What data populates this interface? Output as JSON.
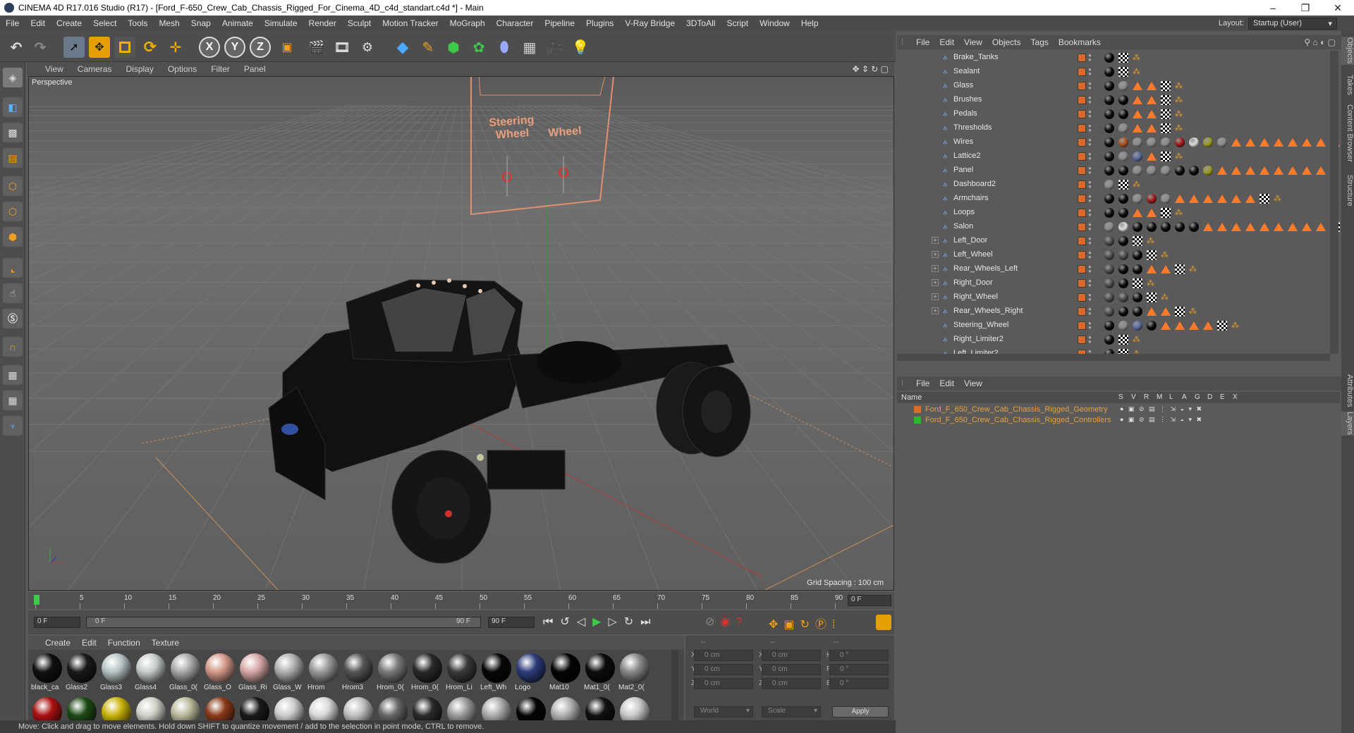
{
  "window": {
    "title": "CINEMA 4D R17.016 Studio (R17) - [Ford_F-650_Crew_Cab_Chassis_Rigged_For_Cinema_4D_c4d_standart.c4d *] - Main",
    "minimize": "–",
    "maximize": "❐",
    "close": "✕"
  },
  "menu": [
    "File",
    "Edit",
    "Create",
    "Select",
    "Tools",
    "Mesh",
    "Snap",
    "Animate",
    "Simulate",
    "Render",
    "Sculpt",
    "Motion Tracker",
    "MoGraph",
    "Character",
    "Pipeline",
    "Plugins",
    "V-Ray Bridge",
    "3DToAll",
    "Script",
    "Window",
    "Help"
  ],
  "layout": {
    "label": "Layout:",
    "value": "Startup (User)"
  },
  "toolbar": {
    "axis_x": "X",
    "axis_y": "Y",
    "axis_z": "Z"
  },
  "viewport": {
    "menu": [
      "View",
      "Cameras",
      "Display",
      "Options",
      "Filter",
      "Panel"
    ],
    "label": "Perspective",
    "grid_spacing": "Grid Spacing : 100 cm",
    "controller_labels": [
      "Steering Wheel",
      "Wheel"
    ]
  },
  "timeline": {
    "ticks": [
      "0",
      "5",
      "10",
      "15",
      "20",
      "25",
      "30",
      "35",
      "40",
      "45",
      "50",
      "55",
      "60",
      "65",
      "70",
      "75",
      "80",
      "85",
      "90"
    ],
    "current_frame": "0 F",
    "start_field": "0 F",
    "range_start": "0 F",
    "range_end": "90 F",
    "end_field": "90 F"
  },
  "materials": {
    "menu": [
      "Create",
      "Edit",
      "Function",
      "Texture"
    ],
    "row1": [
      {
        "name": "black_ca",
        "color": "#111111"
      },
      {
        "name": "Glass2",
        "color": "#1a1a1a"
      },
      {
        "name": "Glass3",
        "color": "#b8c4c4"
      },
      {
        "name": "Glass4",
        "color": "#c8cccc"
      },
      {
        "name": "Glass_0(",
        "color": "#a8aaaa"
      },
      {
        "name": "Glass_O",
        "color": "#d49a8a"
      },
      {
        "name": "Glass_Ri",
        "color": "#d8a8a8"
      },
      {
        "name": "Glass_W",
        "color": "#b0b0b0"
      },
      {
        "name": "Hrom",
        "color": "#9a9a9a"
      },
      {
        "name": "Hrom3",
        "color": "#555555"
      },
      {
        "name": "Hrom_0(",
        "color": "#7a7a7a"
      },
      {
        "name": "Hrom_0(",
        "color": "#2a2a2a"
      },
      {
        "name": "Hrom_Li",
        "color": "#3a3a3a"
      },
      {
        "name": "Left_Wh",
        "color": "#080808"
      },
      {
        "name": "Logo",
        "color": "#2c3c7a"
      },
      {
        "name": "Mat10",
        "color": "#050505"
      },
      {
        "name": "Mat1_0(",
        "color": "#0c0c0c"
      },
      {
        "name": "Mat2_0(",
        "color": "#888888"
      }
    ],
    "row2": [
      "#aa1111",
      "#1e4a14",
      "#c9b20c",
      "#d0d0c8",
      "#b8b89a",
      "#8a3a1a",
      "#1a1a1a",
      "#cccccc",
      "#d8d8d8",
      "#c0c0c0",
      "#666666",
      "#2a2a2a",
      "#999999",
      "#aaaaaa",
      "#050505",
      "#b0b0b0",
      "#111111",
      "#c8c8c8"
    ]
  },
  "coords": {
    "headers": [
      "--",
      "--",
      "--"
    ],
    "rows": [
      {
        "a": "X",
        "av": "0 cm",
        "b": "X",
        "bv": "0 cm",
        "c": "H",
        "cv": "0 °"
      },
      {
        "a": "Y",
        "av": "0 cm",
        "b": "Y",
        "bv": "0 cm",
        "c": "P",
        "cv": "0 °"
      },
      {
        "a": "Z",
        "av": "0 cm",
        "b": "Z",
        "bv": "0 cm",
        "c": "B",
        "cv": "0 °"
      }
    ],
    "world": "World",
    "scale": "Scale",
    "apply": "Apply"
  },
  "status": "Move: Click and drag to move elements. Hold down SHIFT to quantize movement / add to the selection in point mode, CTRL to remove.",
  "objects": {
    "menu": [
      "File",
      "Edit",
      "View",
      "Objects",
      "Tags",
      "Bookmarks"
    ],
    "rows": [
      {
        "name": "Brake_Tanks",
        "tags": "bkc"
      },
      {
        "name": "Sealant",
        "tags": "bkc"
      },
      {
        "name": "Glass",
        "tags": "bgttkc"
      },
      {
        "name": "Brushes",
        "tags": "bbttkc"
      },
      {
        "name": "Pedals",
        "tags": "bbttkc"
      },
      {
        "name": "Thresholds",
        "tags": "bgttkc"
      },
      {
        "name": "Wires",
        "tags": "bogggrwygtttttttt"
      },
      {
        "name": "Lattice2",
        "tags": "bgftkc"
      },
      {
        "name": "Panel",
        "tags": "bbgggbbytttttttt"
      },
      {
        "name": "Dashboard2",
        "tags": "gkc"
      },
      {
        "name": "Armchairs",
        "tags": "bbgrgttttttkc"
      },
      {
        "name": "Loops",
        "tags": "bbttkc"
      },
      {
        "name": "Salon",
        "tags": "gwbbbbbtttttttttkc"
      },
      {
        "name": "Left_Door",
        "tags": "nbkc",
        "plus": true
      },
      {
        "name": "Left_Wheel",
        "tags": "nnbkc",
        "plus": true
      },
      {
        "name": "Rear_Wheels_Left",
        "tags": "nbbttkc",
        "plus": true
      },
      {
        "name": "Right_Door",
        "tags": "nbkc",
        "plus": true
      },
      {
        "name": "Right_Wheel",
        "tags": "nnbkc",
        "plus": true
      },
      {
        "name": "Rear_Wheels_Right",
        "tags": "nbbttkc",
        "plus": true
      },
      {
        "name": "Steering_Wheel",
        "tags": "bgfbttttkc"
      },
      {
        "name": "Right_Limiter2",
        "tags": "bkc"
      },
      {
        "name": "Left_Limiter2",
        "tags": "bkc"
      }
    ]
  },
  "layers": {
    "menu": [
      "File",
      "Edit",
      "View"
    ],
    "header": {
      "name": "Name",
      "cols": [
        "S",
        "V",
        "R",
        "M",
        "L",
        "A",
        "G",
        "D",
        "E",
        "X"
      ]
    },
    "rows": [
      {
        "name": "Ford_F_650_Crew_Cab_Chassis_Rigged_Geometry",
        "color": "#d86a2a",
        "text_color": "#e8a040"
      },
      {
        "name": "Ford_F_650_Crew_Cab_Chassis_Rigged_Controllers",
        "color": "#2ab82a",
        "text_color": "#e8a040"
      }
    ]
  },
  "sidetabs": [
    "Objects",
    "Takes",
    "Content Browser",
    "Structure",
    "Attributes",
    "Layers"
  ]
}
